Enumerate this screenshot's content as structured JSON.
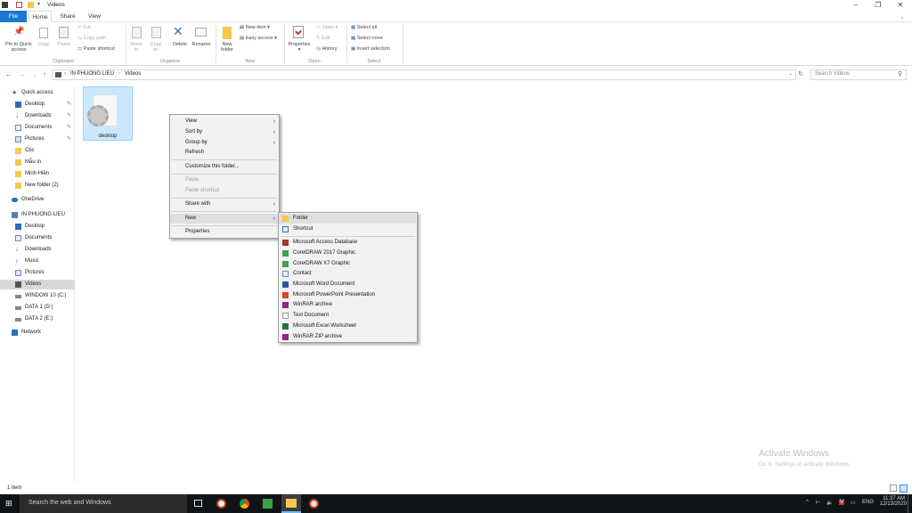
{
  "window": {
    "title": "Videos"
  },
  "tabs": [
    "File",
    "Home",
    "Share",
    "View"
  ],
  "ribbon": {
    "clipboard": {
      "pin_label_line1": "Pin to Quick",
      "pin_label_line2": "access",
      "copy": "Copy",
      "paste": "Paste",
      "cut": "Cut",
      "copy_path": "Copy path",
      "paste_shortcut": "Paste shortcut",
      "group": "Clipboard"
    },
    "organize": {
      "move_to_line1": "Move",
      "move_to_line2": "to",
      "copy_to_line1": "Copy",
      "copy_to_line2": "to",
      "delete": "Delete",
      "rename": "Rename",
      "group": "Organize"
    },
    "new": {
      "new_folder_line1": "New",
      "new_folder_line2": "folder",
      "new_item": "New item",
      "easy_access": "Easy access",
      "group": "New"
    },
    "open": {
      "properties": "Properties",
      "open": "Open",
      "edit": "Edit",
      "history": "History",
      "group": "Open"
    },
    "select": {
      "select_all": "Select all",
      "select_none": "Select none",
      "invert_selection": "Invert selection",
      "group": "Select"
    }
  },
  "address": {
    "path": [
      "IN PHUONG LIEU",
      "Videos"
    ],
    "search_placeholder": "Search Videos"
  },
  "nav": {
    "quick_access": "Quick access",
    "quick_items": [
      "Desktop",
      "Downloads",
      "Documents",
      "Pictures",
      "Cbc",
      "Mẫu in",
      "Minh Hiền",
      "New folder (2)"
    ],
    "onedrive": "OneDrive",
    "this_pc": "IN PHUONG LIEU",
    "pc_items": [
      "Desktop",
      "Documents",
      "Downloads",
      "Music",
      "Pictures",
      "Videos",
      "WINDOW 10 (C:)",
      "DATA 1 (D:)",
      "DATA 2 (E:)"
    ],
    "network": "Network"
  },
  "file": {
    "name": "desktop"
  },
  "context_menu": {
    "view": "View",
    "sort_by": "Sort by",
    "group_by": "Group by",
    "refresh": "Refresh",
    "customize": "Customize this folder...",
    "paste": "Paste",
    "paste_shortcut": "Paste shortcut",
    "share_with": "Share with",
    "new": "New",
    "properties": "Properties"
  },
  "new_submenu": {
    "items": [
      "Folder",
      "Shortcut",
      "Microsoft Access Database",
      "CorelDRAW 2017 Graphic",
      "CorelDRAW X7 Graphic",
      "Contact",
      "Microsoft Word Document",
      "Microsoft PowerPoint Presentation",
      "WinRAR archive",
      "Text Document",
      "Microsoft Excel Worksheet",
      "WinRAR ZIP archive"
    ]
  },
  "status": {
    "count": "1 item"
  },
  "watermark": {
    "line1": "Activate Windows",
    "line2": "Go to Settings to activate Windows."
  },
  "taskbar": {
    "search_placeholder": "Search the web and Windows",
    "language": "ENG",
    "time": "11:37 AM",
    "date": "12/13/2020"
  },
  "colors": {
    "file_tab": "#1979ca",
    "selection": "#cce8ff",
    "taskbar": "#111417"
  }
}
